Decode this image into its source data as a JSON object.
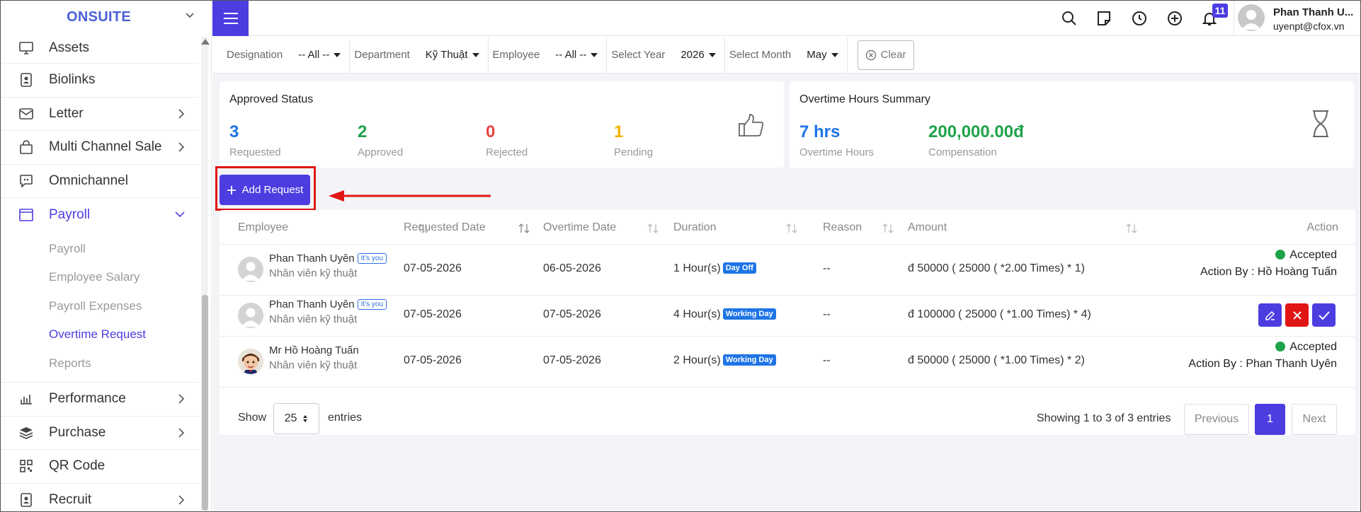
{
  "brand": {
    "name": "ONSUITE"
  },
  "sidebar": {
    "items": [
      {
        "label": "Assets",
        "icon": "monitor-icon"
      },
      {
        "label": "Biolinks",
        "icon": "id-card-icon"
      },
      {
        "label": "Letter",
        "icon": "mail-icon"
      },
      {
        "label": "Multi Channel Sale",
        "icon": "shopping-bag-icon"
      },
      {
        "label": "Omnichannel",
        "icon": "chat-icon"
      },
      {
        "label": "Payroll",
        "icon": "window-icon"
      },
      {
        "label": "Performance",
        "icon": "bar-chart-icon"
      },
      {
        "label": "Purchase",
        "icon": "layers-icon"
      },
      {
        "label": "QR Code",
        "icon": "qr-code-icon"
      },
      {
        "label": "Recruit",
        "icon": "id-badge-icon"
      }
    ],
    "payroll_sub": [
      "Payroll",
      "Employee Salary",
      "Payroll Expenses",
      "Overtime Request",
      "Reports"
    ]
  },
  "header": {
    "notification_count": "11",
    "user_name": "Phan Thanh U...",
    "user_email": "uyenpt@cfox.vn"
  },
  "filters": {
    "designation_label": "Designation",
    "designation_value": "-- All --",
    "department_label": "Department",
    "department_value": "Kỹ Thuật",
    "employee_label": "Employee",
    "employee_value": "-- All --",
    "year_label": "Select Year",
    "year_value": "2026",
    "month_label": "Select Month",
    "month_value": "May",
    "clear_label": "Clear"
  },
  "approved_status": {
    "title": "Approved Status",
    "requested": {
      "value": "3",
      "label": "Requested"
    },
    "approved": {
      "value": "2",
      "label": "Approved"
    },
    "rejected": {
      "value": "0",
      "label": "Rejected"
    },
    "pending": {
      "value": "1",
      "label": "Pending"
    }
  },
  "overtime_summary": {
    "title": "Overtime Hours Summary",
    "hours": {
      "value": "7 hrs",
      "label": "Overtime Hours"
    },
    "compensation": {
      "value": "200,000.00đ",
      "label": "Compensation"
    }
  },
  "add_request_label": "Add Request",
  "table": {
    "headers": [
      "Employee",
      "Requested Date",
      "Overtime Date",
      "Duration",
      "Reason",
      "Amount",
      "Action"
    ],
    "rows": [
      {
        "name": "Phan Thanh Uyên",
        "its_you": "It's you",
        "role": "Nhân viên kỹ thuật",
        "requested_date": "07-05-2026",
        "overtime_date": "06-05-2026",
        "duration": "1 Hour(s)",
        "day_type": "Day Off",
        "reason": "--",
        "amount": "đ 50000 ( 25000 ( *2.00 Times) * 1)",
        "status": "Accepted",
        "action_by": "Action By : Hồ Hoàng Tuấn"
      },
      {
        "name": "Phan Thanh Uyên",
        "its_you": "It's you",
        "role": "Nhân viên kỹ thuật",
        "requested_date": "07-05-2026",
        "overtime_date": "07-05-2026",
        "duration": "4 Hour(s)",
        "day_type": "Working Day",
        "reason": "--",
        "amount": "đ 100000 ( 25000 ( *1.00 Times) * 4)"
      },
      {
        "name": "Mr Hồ Hoàng Tuấn",
        "role": "Nhân viên kỹ thuật",
        "requested_date": "07-05-2026",
        "overtime_date": "07-05-2026",
        "duration": "2 Hour(s)",
        "day_type": "Working Day",
        "reason": "--",
        "amount": "đ 50000 ( 25000 ( *1.00 Times) * 2)",
        "status": "Accepted",
        "action_by": "Action By : Phan Thanh Uyên"
      }
    ],
    "show_label": "Show",
    "entries_value": "25",
    "entries_label": "entries",
    "info": "Showing 1 to 3 of 3 entries",
    "prev": "Previous",
    "page": "1",
    "next": "Next"
  },
  "colors": {
    "accent": "#4c3de0",
    "requested": "#1e74e6",
    "approved": "#1fa34a",
    "rejected": "#e84343",
    "pending": "#f4b400",
    "danger": "#e01515"
  }
}
